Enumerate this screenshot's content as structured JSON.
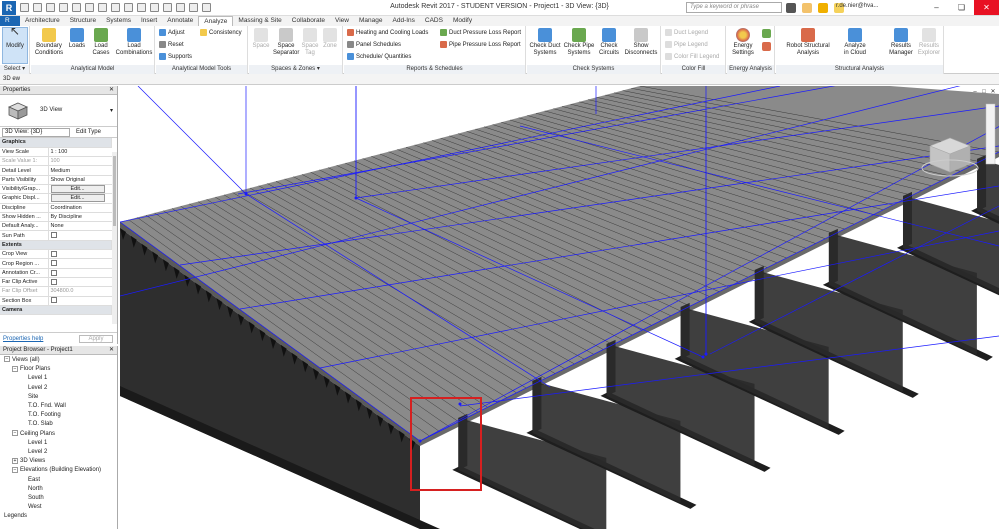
{
  "title_bar": {
    "app_logo": "R",
    "title": "Autodesk Revit 2017 - STUDENT VERSION -     Project1 - 3D View: {3D}",
    "search_placeholder": "Type a keyword or phrase",
    "user": "r.de.nier@hva...",
    "minimize": "–",
    "restore": "❏",
    "close": "✕"
  },
  "tabs": [
    {
      "label": "R"
    },
    {
      "label": "Architecture"
    },
    {
      "label": "Structure"
    },
    {
      "label": "Systems"
    },
    {
      "label": "Insert"
    },
    {
      "label": "Annotate"
    },
    {
      "label": "Analyze"
    },
    {
      "label": "Massing & Site"
    },
    {
      "label": "Collaborate"
    },
    {
      "label": "View"
    },
    {
      "label": "Manage"
    },
    {
      "label": "Add-Ins"
    },
    {
      "label": "CADS"
    },
    {
      "label": "Modify"
    }
  ],
  "ribbon": {
    "select": {
      "modify": "Modify",
      "title": "Select ▾"
    },
    "analytical_model": {
      "boundary": "Boundary Conditions",
      "loads": "Loads",
      "load_cases": "Load Cases",
      "load_combinations": "Load Combinations",
      "title": "Analytical Model"
    },
    "analytical_tools": {
      "adjust": "Adjust",
      "reset": "Reset",
      "supports": "Supports",
      "consistency": "Consistency",
      "title": "Analytical Model Tools"
    },
    "spaces": {
      "space": "Space",
      "separator": "Space Separator",
      "tag": "Space Tag",
      "zone": "Zone",
      "title": "Spaces & Zones ▾"
    },
    "reports": {
      "heating": "Heating and Cooling Loads",
      "panel": "Panel Schedules",
      "schedule": "Schedule/ Quantities",
      "duct": "Duct Pressure Loss Report",
      "pipe": "Pipe Pressure Loss Report",
      "title": "Reports & Schedules"
    },
    "check_systems": {
      "duct": "Check Duct Systems",
      "pipe": "Check Pipe Systems",
      "circuits": "Check Circuits",
      "disconnects": "Show Disconnects",
      "title": "Check Systems"
    },
    "color_fill": {
      "duct_legend": "Duct Legend",
      "pipe_legend": "Pipe Legend",
      "color_fill_legend": "Color Fill Legend",
      "title": "Color Fill"
    },
    "energy": {
      "settings": "Energy Settings",
      "title": "Energy Analysis"
    },
    "structural": {
      "robot": "Robot Structural Analysis",
      "cloud": "Analyze in Cloud",
      "results_manager": "Results Manager",
      "results_explorer": "Results Explorer",
      "title": "Structural Analysis"
    }
  },
  "options_bar": {
    "label": "3D    ew"
  },
  "properties": {
    "header": "Properties",
    "close": "✕",
    "type_name": "3D View",
    "instance": "3D View: {3D}",
    "edit_type": "Edit Type",
    "rows": [
      {
        "k": "Graphics",
        "v": "",
        "group": true
      },
      {
        "k": "View Scale",
        "v": "1 : 100"
      },
      {
        "k": "Scale Value    1:",
        "v": "100",
        "dim": true
      },
      {
        "k": "Detail Level",
        "v": "Medium"
      },
      {
        "k": "Parts Visibility",
        "v": "Show Original"
      },
      {
        "k": "Visibility/Grap...",
        "v": "Edit...",
        "button": true
      },
      {
        "k": "Graphic Displ...",
        "v": "Edit...",
        "button": true
      },
      {
        "k": "Discipline",
        "v": "Coordination"
      },
      {
        "k": "Show Hidden ...",
        "v": "By Discipline"
      },
      {
        "k": "Default Analy...",
        "v": "None"
      },
      {
        "k": "Sun Path",
        "v": "",
        "check": true
      },
      {
        "k": "Extents",
        "v": "",
        "group": true
      },
      {
        "k": "Crop View",
        "v": "",
        "check": true
      },
      {
        "k": "Crop Region ...",
        "v": "",
        "check": true
      },
      {
        "k": "Annotation Cr...",
        "v": "",
        "check": true
      },
      {
        "k": "Far Clip Active",
        "v": "",
        "check": true
      },
      {
        "k": "Far Clip Offset",
        "v": "304800.0",
        "dim": true
      },
      {
        "k": "Section Box",
        "v": "",
        "check": true
      },
      {
        "k": "Camera",
        "v": "",
        "group": true
      }
    ],
    "help": "Properties help",
    "apply": "Apply"
  },
  "project_browser": {
    "header": "Project Browser - Project1",
    "close": "✕",
    "items": [
      {
        "label": "Views (all)",
        "indent": 0,
        "exp": "−"
      },
      {
        "label": "Floor Plans",
        "indent": 1,
        "exp": "−"
      },
      {
        "label": "Level 1",
        "indent": 3
      },
      {
        "label": "Level 2",
        "indent": 3
      },
      {
        "label": "Site",
        "indent": 3
      },
      {
        "label": "T.O. Fnd. Wall",
        "indent": 3
      },
      {
        "label": "T.O. Footing",
        "indent": 3
      },
      {
        "label": "T.O. Slab",
        "indent": 3
      },
      {
        "label": "Ceiling Plans",
        "indent": 1,
        "exp": "−"
      },
      {
        "label": "Level 1",
        "indent": 3
      },
      {
        "label": "Level 2",
        "indent": 3
      },
      {
        "label": "3D Views",
        "indent": 1,
        "exp": "+"
      },
      {
        "label": "Elevations (Building Elevation)",
        "indent": 1,
        "exp": "−"
      },
      {
        "label": "East",
        "indent": 3
      },
      {
        "label": "North",
        "indent": 3
      },
      {
        "label": "South",
        "indent": 3
      },
      {
        "label": "West",
        "indent": 3
      },
      {
        "label": "Legends",
        "indent": 0
      }
    ]
  },
  "viewport": {
    "controls": [
      "–",
      "□",
      "✕"
    ],
    "highlight_color": "#d62020",
    "analytical_color": "#1a1aff"
  },
  "colors": {
    "accent": "#1b66b3",
    "steel": "#2c2c2c",
    "slab": "#7a7a7a"
  }
}
